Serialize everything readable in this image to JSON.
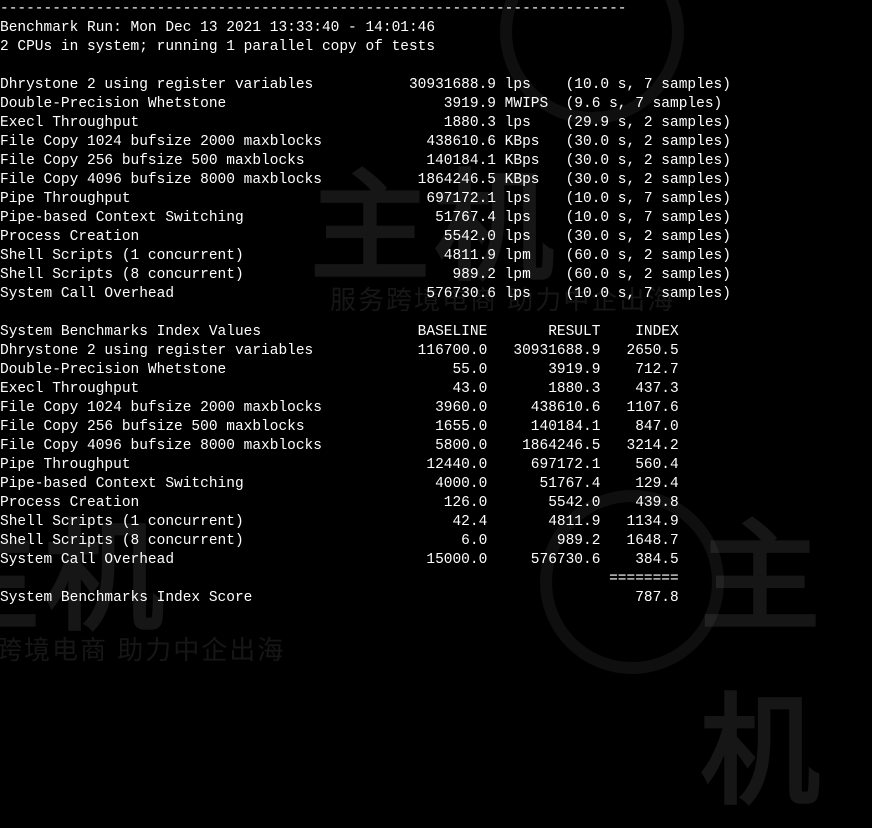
{
  "divider": "------------------------------------------------------------------------",
  "header": {
    "run_line": "Benchmark Run: Mon Dec 13 2021 13:33:40 - 14:01:46",
    "cpu_line": "2 CPUs in system; running 1 parallel copy of tests"
  },
  "results": [
    {
      "name": "Dhrystone 2 using register variables",
      "value": "30931688.9",
      "unit": "lps",
      "time": "10.0",
      "samples": "7"
    },
    {
      "name": "Double-Precision Whetstone",
      "value": "3919.9",
      "unit": "MWIPS",
      "time": "9.6",
      "samples": "7"
    },
    {
      "name": "Execl Throughput",
      "value": "1880.3",
      "unit": "lps",
      "time": "29.9",
      "samples": "2"
    },
    {
      "name": "File Copy 1024 bufsize 2000 maxblocks",
      "value": "438610.6",
      "unit": "KBps",
      "time": "30.0",
      "samples": "2"
    },
    {
      "name": "File Copy 256 bufsize 500 maxblocks",
      "value": "140184.1",
      "unit": "KBps",
      "time": "30.0",
      "samples": "2"
    },
    {
      "name": "File Copy 4096 bufsize 8000 maxblocks",
      "value": "1864246.5",
      "unit": "KBps",
      "time": "30.0",
      "samples": "2"
    },
    {
      "name": "Pipe Throughput",
      "value": "697172.1",
      "unit": "lps",
      "time": "10.0",
      "samples": "7"
    },
    {
      "name": "Pipe-based Context Switching",
      "value": "51767.4",
      "unit": "lps",
      "time": "10.0",
      "samples": "7"
    },
    {
      "name": "Process Creation",
      "value": "5542.0",
      "unit": "lps",
      "time": "30.0",
      "samples": "2"
    },
    {
      "name": "Shell Scripts (1 concurrent)",
      "value": "4811.9",
      "unit": "lpm",
      "time": "60.0",
      "samples": "2"
    },
    {
      "name": "Shell Scripts (8 concurrent)",
      "value": "989.2",
      "unit": "lpm",
      "time": "60.0",
      "samples": "2"
    },
    {
      "name": "System Call Overhead",
      "value": "576730.6",
      "unit": "lps",
      "time": "10.0",
      "samples": "7"
    }
  ],
  "index_header": {
    "title": "System Benchmarks Index Values",
    "c1": "BASELINE",
    "c2": "RESULT",
    "c3": "INDEX"
  },
  "index_rows": [
    {
      "name": "Dhrystone 2 using register variables",
      "baseline": "116700.0",
      "result": "30931688.9",
      "index": "2650.5"
    },
    {
      "name": "Double-Precision Whetstone",
      "baseline": "55.0",
      "result": "3919.9",
      "index": "712.7"
    },
    {
      "name": "Execl Throughput",
      "baseline": "43.0",
      "result": "1880.3",
      "index": "437.3"
    },
    {
      "name": "File Copy 1024 bufsize 2000 maxblocks",
      "baseline": "3960.0",
      "result": "438610.6",
      "index": "1107.6"
    },
    {
      "name": "File Copy 256 bufsize 500 maxblocks",
      "baseline": "1655.0",
      "result": "140184.1",
      "index": "847.0"
    },
    {
      "name": "File Copy 4096 bufsize 8000 maxblocks",
      "baseline": "5800.0",
      "result": "1864246.5",
      "index": "3214.2"
    },
    {
      "name": "Pipe Throughput",
      "baseline": "12440.0",
      "result": "697172.1",
      "index": "560.4"
    },
    {
      "name": "Pipe-based Context Switching",
      "baseline": "4000.0",
      "result": "51767.4",
      "index": "129.4"
    },
    {
      "name": "Process Creation",
      "baseline": "126.0",
      "result": "5542.0",
      "index": "439.8"
    },
    {
      "name": "Shell Scripts (1 concurrent)",
      "baseline": "42.4",
      "result": "4811.9",
      "index": "1134.9"
    },
    {
      "name": "Shell Scripts (8 concurrent)",
      "baseline": "6.0",
      "result": "989.2",
      "index": "1648.7"
    },
    {
      "name": "System Call Overhead",
      "baseline": "15000.0",
      "result": "576730.6",
      "index": "384.5"
    }
  ],
  "index_rule": "========",
  "score": {
    "label": "System Benchmarks Index Score",
    "value": "787.8"
  },
  "watermark": {
    "big": "主机",
    "small": "服务跨境电商 助力中企出海"
  }
}
